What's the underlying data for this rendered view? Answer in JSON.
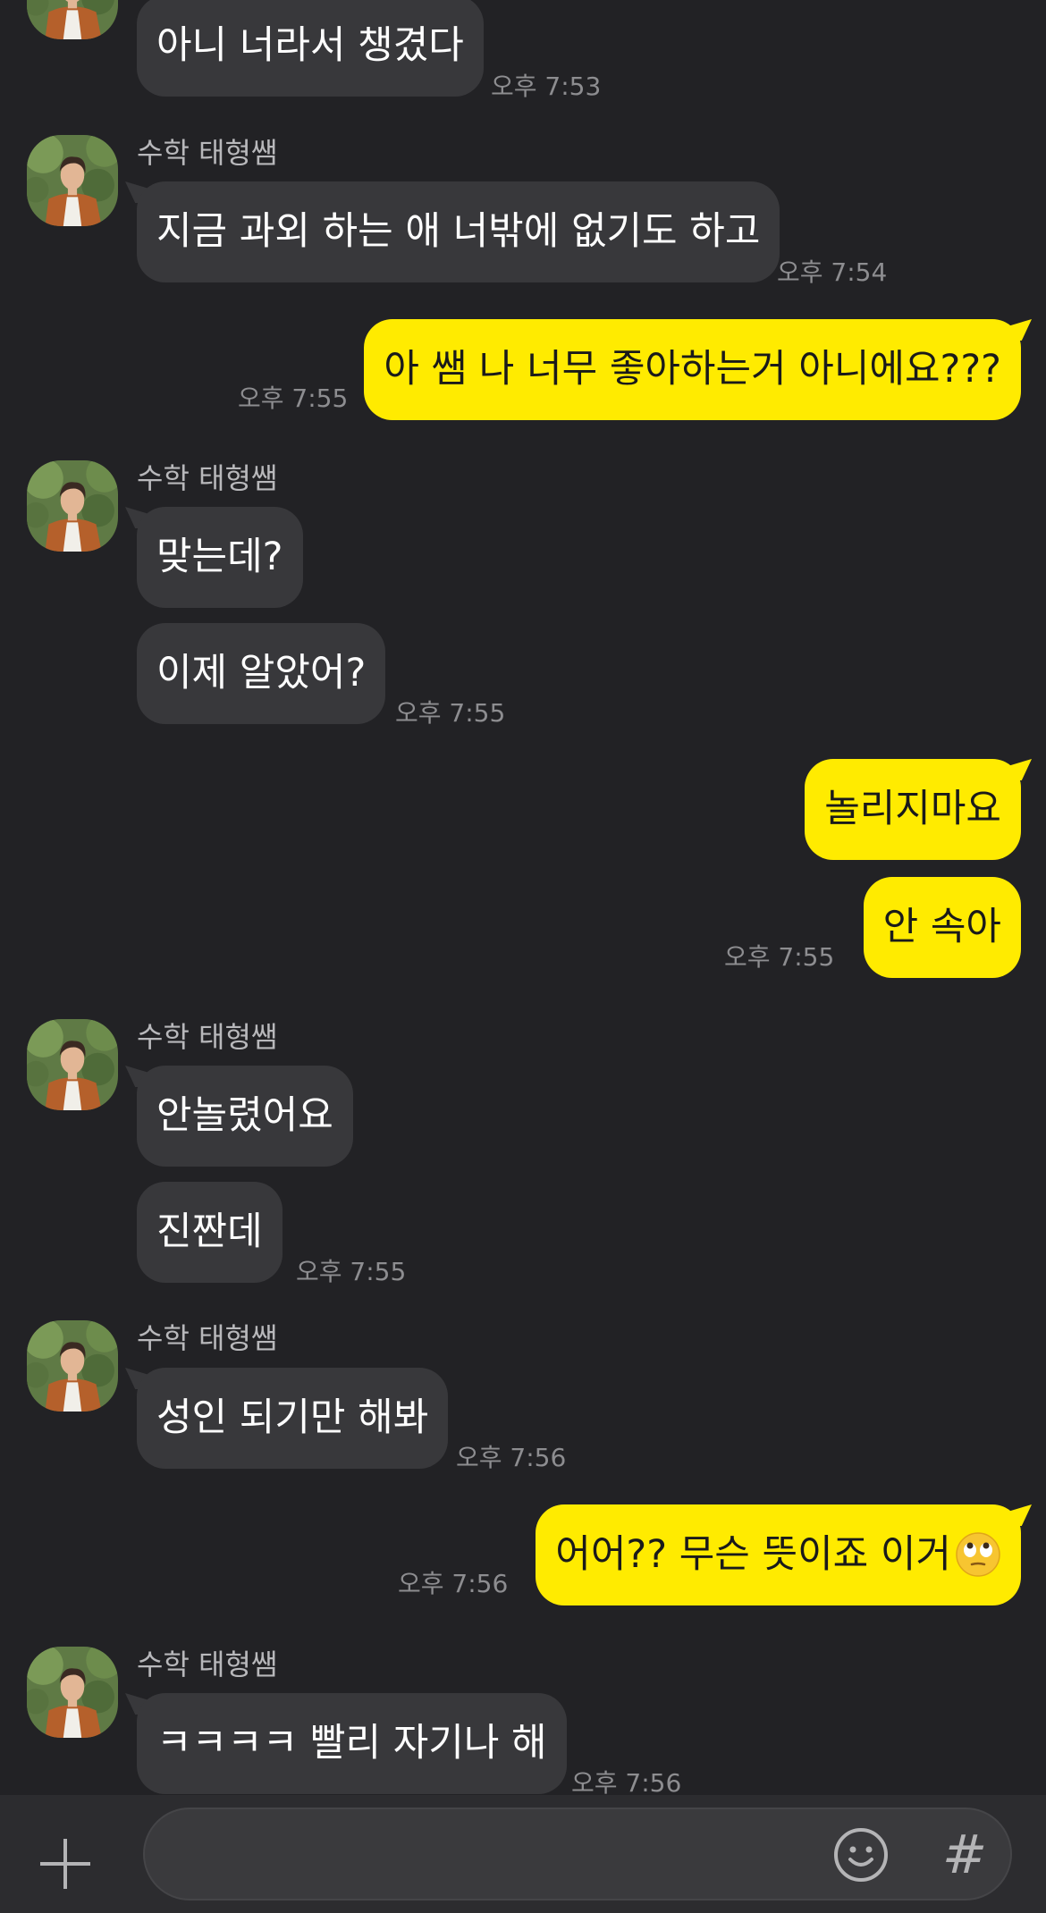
{
  "chat": {
    "messages": [
      {
        "id": "m1",
        "direction": "in",
        "text": "아니 너라서 챙겼다",
        "time": "오후 7:53"
      },
      {
        "id": "m2",
        "direction": "in",
        "sender": "수학 태형쌤",
        "text": "지금 과외 하는 애 너밖에 없기도 하고",
        "time": "오후 7:54"
      },
      {
        "id": "m3",
        "direction": "out",
        "text": "아 쌤 나 너무 좋아하는거 아니에요???",
        "time": "오후 7:55"
      },
      {
        "id": "m4",
        "direction": "in",
        "sender": "수학 태형쌤",
        "text": "맞는데?"
      },
      {
        "id": "m5",
        "direction": "in",
        "text": "이제 알았어?",
        "time": "오후 7:55"
      },
      {
        "id": "m6",
        "direction": "out",
        "text": "놀리지마요"
      },
      {
        "id": "m7",
        "direction": "out",
        "text": "안 속아",
        "time": "오후 7:55"
      },
      {
        "id": "m8",
        "direction": "in",
        "sender": "수학 태형쌤",
        "text": "안놀렸어요"
      },
      {
        "id": "m9",
        "direction": "in",
        "text": "진짠데",
        "time": "오후 7:55"
      },
      {
        "id": "m10",
        "direction": "in",
        "sender": "수학 태형쌤",
        "text": "성인 되기만 해봐",
        "time": "오후 7:56"
      },
      {
        "id": "m11",
        "direction": "out",
        "text": "어어?? 무슨 뜻이죠 이거",
        "emoji": "eye-roll-emoji",
        "time": "오후 7:56"
      },
      {
        "id": "m12",
        "direction": "in",
        "sender": "수학 태형쌤",
        "text": "ㅋㅋㅋㅋ 빨리 자기나 해",
        "time": "오후 7:56"
      }
    ]
  },
  "input_bar": {
    "value": "",
    "placeholder": "",
    "icons": [
      "plus-icon",
      "smiley-icon",
      "hash-icon"
    ],
    "hash_label": "#"
  },
  "colors": {
    "background": "#222225",
    "incoming_bubble": "#38383b",
    "outgoing_bubble": "#ffeb00",
    "timestamp": "#8d8d90",
    "sender_name": "#b8b8bb"
  }
}
